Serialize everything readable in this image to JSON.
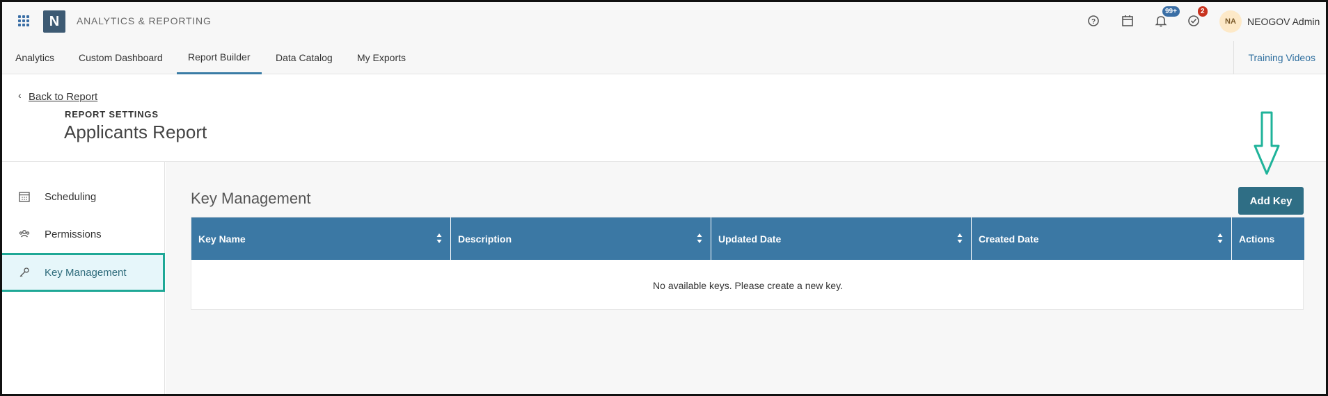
{
  "app": {
    "logo_letter": "N",
    "title": "ANALYTICS & REPORTING"
  },
  "topbar": {
    "icons": [
      "help-icon",
      "calendar-icon",
      "bell-icon",
      "check-circle-icon"
    ],
    "notifications_badge": "99+",
    "tasks_badge": "2",
    "user_initials": "NA",
    "user_name": "NEOGOV Admin"
  },
  "nav": {
    "tabs": [
      {
        "label": "Analytics"
      },
      {
        "label": "Custom Dashboard"
      },
      {
        "label": "Report Builder",
        "active": true
      },
      {
        "label": "Data Catalog"
      },
      {
        "label": "My Exports"
      }
    ],
    "training_videos": "Training Videos"
  },
  "header": {
    "back_link": "Back to Report",
    "settings_label": "REPORT SETTINGS",
    "title": "Applicants Report"
  },
  "sidebar": {
    "items": [
      {
        "label": "Scheduling",
        "icon": "calendar-grid-icon"
      },
      {
        "label": "Permissions",
        "icon": "users-icon"
      },
      {
        "label": "Key Management",
        "icon": "key-icon",
        "active": true
      }
    ]
  },
  "main": {
    "title": "Key Management",
    "add_key_label": "Add Key",
    "table": {
      "columns": [
        "Key Name",
        "Description",
        "Updated Date",
        "Created Date",
        "Actions"
      ],
      "empty_message": "No available keys. Please create a new key."
    }
  },
  "colors": {
    "accent": "#3b78a4",
    "button": "#2f6e85",
    "highlight_border": "#1fa896",
    "notification_badge": "#3a6ea5",
    "task_badge": "#c8321e"
  }
}
